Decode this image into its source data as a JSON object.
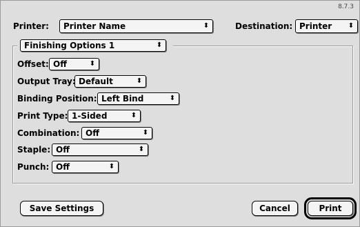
{
  "version": "8.7.3",
  "header": {
    "printer_label": "Printer:",
    "printer_value": "Printer Name",
    "destination_label": "Destination:",
    "destination_value": "Printer"
  },
  "panel": {
    "selected": "Finishing Options 1"
  },
  "options": {
    "offset": {
      "label": "Offset:",
      "value": "Off"
    },
    "output_tray": {
      "label": "Output Tray:",
      "value": "Default"
    },
    "binding_position": {
      "label": "Binding Position:",
      "value": "Left Bind"
    },
    "print_type": {
      "label": "Print Type:",
      "value": "1-Sided"
    },
    "combination": {
      "label": "Combination:",
      "value": "Off"
    },
    "staple": {
      "label": "Staple:",
      "value": "Off"
    },
    "punch": {
      "label": "Punch:",
      "value": "Off"
    }
  },
  "buttons": {
    "save_settings": "Save Settings",
    "cancel": "Cancel",
    "print": "Print"
  },
  "icons": {
    "popup_arrows": "⬍"
  }
}
